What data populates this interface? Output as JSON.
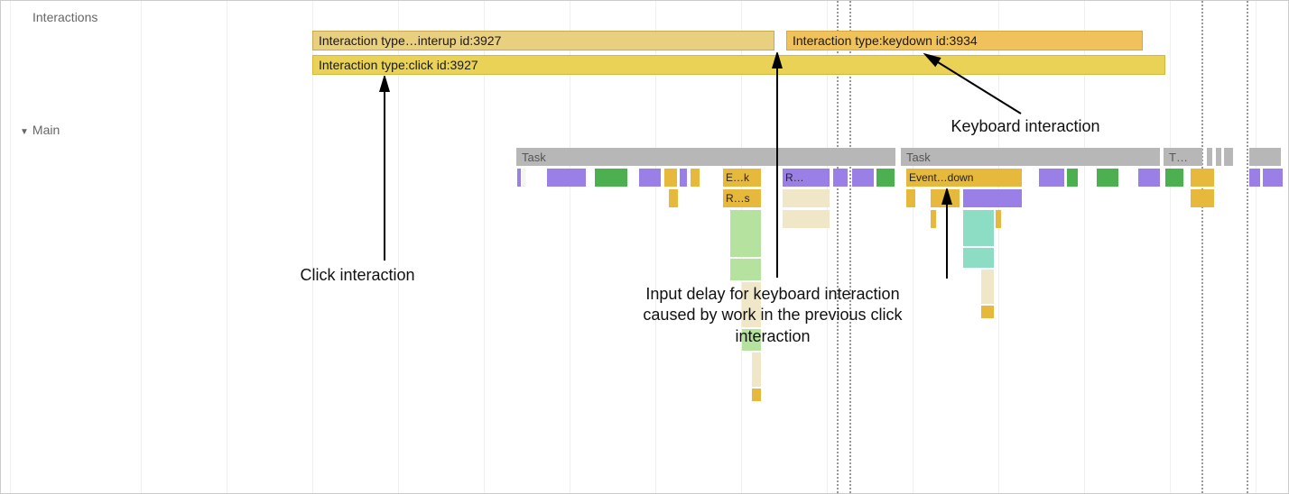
{
  "tracks": {
    "interactions_label": "Interactions",
    "main_label": "Main"
  },
  "interactions": {
    "bar_pointerup": "Interaction type…interup id:3927",
    "bar_click": "Interaction type:click id:3927",
    "bar_keydown": "Interaction type:keydown id:3934"
  },
  "main": {
    "task1_label": "Task",
    "task2_label": "Task",
    "task3_label": "T…",
    "event_ek": "E…k",
    "event_r": "R…",
    "event_rs": "R…s",
    "event_down": "Event…down"
  },
  "annotations": {
    "click_interaction": "Click interaction",
    "keyboard_interaction": "Keyboard interaction",
    "input_delay": "Input delay for keyboard interaction caused by work in the previous click interaction"
  },
  "colors": {
    "muted_gold": "#e9cf80",
    "orange": "#f0c25b",
    "yellow_gold": "#e9d255",
    "task_grey": "#b7b7b7",
    "purple": "#9a80e6",
    "green": "#4caf50",
    "gold": "#e6b83c"
  }
}
